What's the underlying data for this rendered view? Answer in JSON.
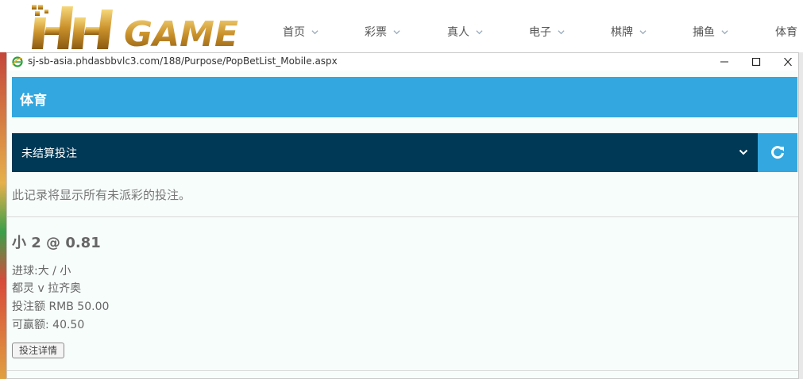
{
  "site": {
    "logo_text": "HH GAME",
    "nav": [
      {
        "label": "首页"
      },
      {
        "label": "彩票"
      },
      {
        "label": "真人"
      },
      {
        "label": "电子"
      },
      {
        "label": "棋牌"
      },
      {
        "label": "捕鱼"
      },
      {
        "label": "体育"
      }
    ]
  },
  "popup": {
    "url": "sj-sb-asia.phdasbbvlc3.com/188/Purpose/PopBetList_Mobile.aspx",
    "panel_title": "体育",
    "filter_selected": "未结算投注",
    "info": "此记录将显示所有未派彩的投注。",
    "bet": {
      "title": "小 2 @ 0.81",
      "market": "进球:大 / 小",
      "match": "都灵 v 拉齐奥",
      "stake": "投注额 RMB 50.00",
      "potential_win": "可赢额: 40.50",
      "details_button": "投注详情"
    }
  },
  "colors": {
    "panel_blue": "#33a7df",
    "filter_navy": "#003956",
    "popup_bg": "#f7fdfb"
  }
}
